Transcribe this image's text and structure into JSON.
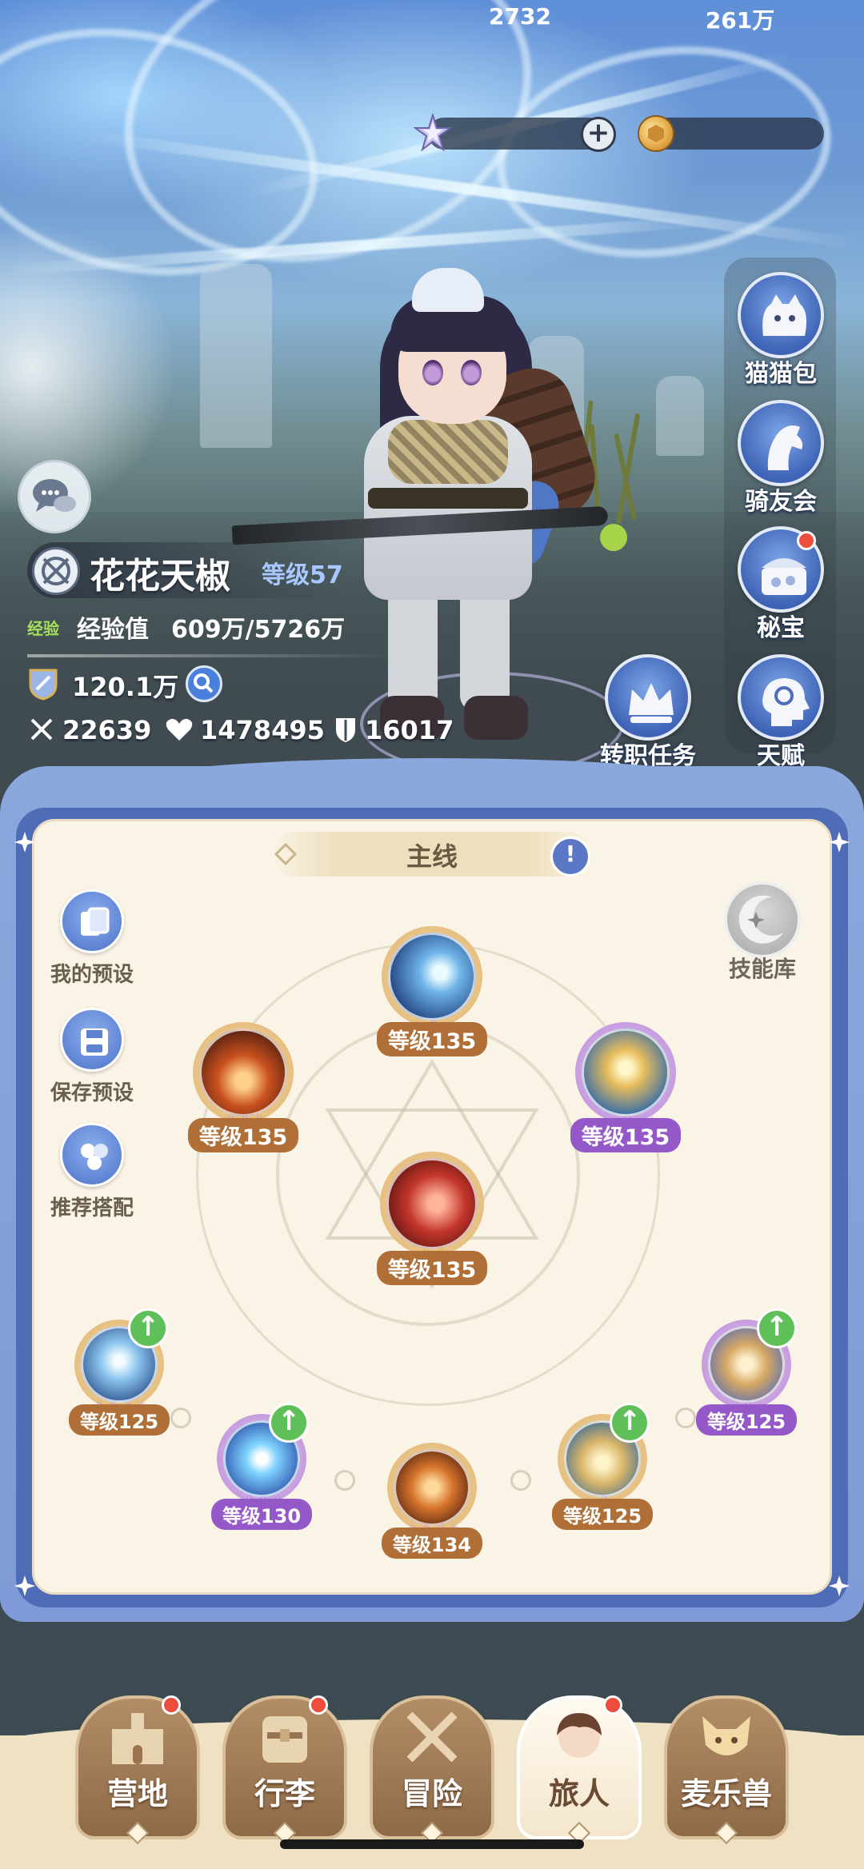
{
  "currencies": {
    "stars": "2732",
    "plus_symbol": "+",
    "gold": "261万"
  },
  "right_menu": [
    {
      "label": "猫猫包",
      "badge": false
    },
    {
      "label": "骑友会",
      "badge": false
    },
    {
      "label": "秘宝",
      "badge": true
    },
    {
      "label": "天赋",
      "badge": false
    }
  ],
  "job_quest": {
    "label": "转职任务"
  },
  "player": {
    "name": "花花天椒",
    "level": "等级57",
    "exp_tag": "经验",
    "exp_label": "经验值",
    "exp_value": "609万/5726万",
    "power": "120.1万",
    "attack": "22639",
    "hp": "1478495",
    "defense": "16017"
  },
  "panel": {
    "tab_label": "主线",
    "side_buttons": [
      {
        "label": "我的预设"
      },
      {
        "label": "保存预设"
      },
      {
        "label": "推荐搭配"
      }
    ],
    "skill_library": "技能库",
    "skills": [
      {
        "level": "等级135",
        "stars": "✦",
        "star_color": "purple",
        "rarity": "gold",
        "upgrade": false
      },
      {
        "level": "等级135",
        "stars": "✦✦✦",
        "star_color": "purple",
        "rarity": "gold",
        "upgrade": false
      },
      {
        "level": "等级135",
        "stars": "✦",
        "star_color": "purple",
        "rarity": "purple",
        "upgrade": false
      },
      {
        "level": "等级135",
        "stars": "✦✦",
        "star_color": "gold",
        "rarity": "gold",
        "upgrade": false
      },
      {
        "level": "等级125",
        "stars": "✦✦✦✦",
        "star_color": "purple",
        "rarity": "gold",
        "upgrade": true
      },
      {
        "level": "等级130",
        "stars": "✦✦✦",
        "star_color": "purple",
        "rarity": "purple",
        "upgrade": true
      },
      {
        "level": "等级134",
        "stars": "✦✦✦✦",
        "star_color": "purple",
        "rarity": "gold",
        "upgrade": false
      },
      {
        "level": "等级125",
        "stars": "✦",
        "star_color": "purple",
        "rarity": "gold",
        "upgrade": true
      },
      {
        "level": "等级125",
        "stars": "✦",
        "star_color": "purple",
        "rarity": "purple",
        "upgrade": true
      }
    ]
  },
  "bottom_nav": [
    {
      "label": "营地",
      "badge": true,
      "active": false
    },
    {
      "label": "行李",
      "badge": true,
      "active": false
    },
    {
      "label": "冒险",
      "badge": false,
      "active": false
    },
    {
      "label": "旅人",
      "badge": true,
      "active": true
    },
    {
      "label": "麦乐兽",
      "badge": false,
      "active": false
    }
  ],
  "colors": {
    "accent_blue": "#4f6cb7",
    "paper": "#faf4e6",
    "level_gold": "#b06f36",
    "level_purple": "#9458c8",
    "badge_red": "#ee4d3d",
    "upgrade_green": "#5fbf58"
  }
}
